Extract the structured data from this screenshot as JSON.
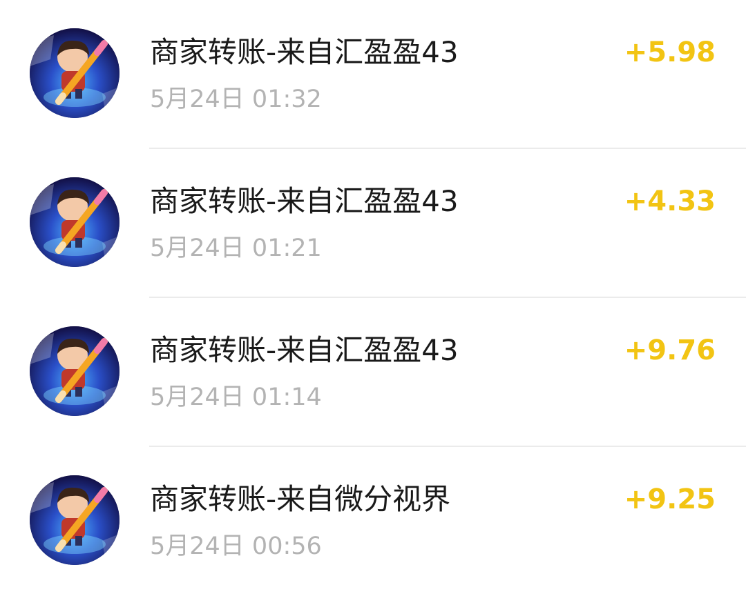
{
  "transactions": [
    {
      "title": "商家转账-来自汇盈盈43",
      "time": "5月24日 01:32",
      "amount": "+5.98",
      "avatar_icon": "cartoon-boy-with-pencil-avatar"
    },
    {
      "title": "商家转账-来自汇盈盈43",
      "time": "5月24日 01:21",
      "amount": "+4.33",
      "avatar_icon": "cartoon-boy-with-pencil-avatar"
    },
    {
      "title": "商家转账-来自汇盈盈43",
      "time": "5月24日 01:14",
      "amount": "+9.76",
      "avatar_icon": "cartoon-boy-with-pencil-avatar"
    },
    {
      "title": "商家转账-来自微分视界",
      "time": "5月24日 00:56",
      "amount": "+9.25",
      "avatar_icon": "cartoon-boy-with-pencil-avatar"
    }
  ],
  "colors": {
    "amount": "#f2c413",
    "title": "#1a1a1a",
    "time": "#b3b3b3",
    "divider": "#ebebeb"
  }
}
